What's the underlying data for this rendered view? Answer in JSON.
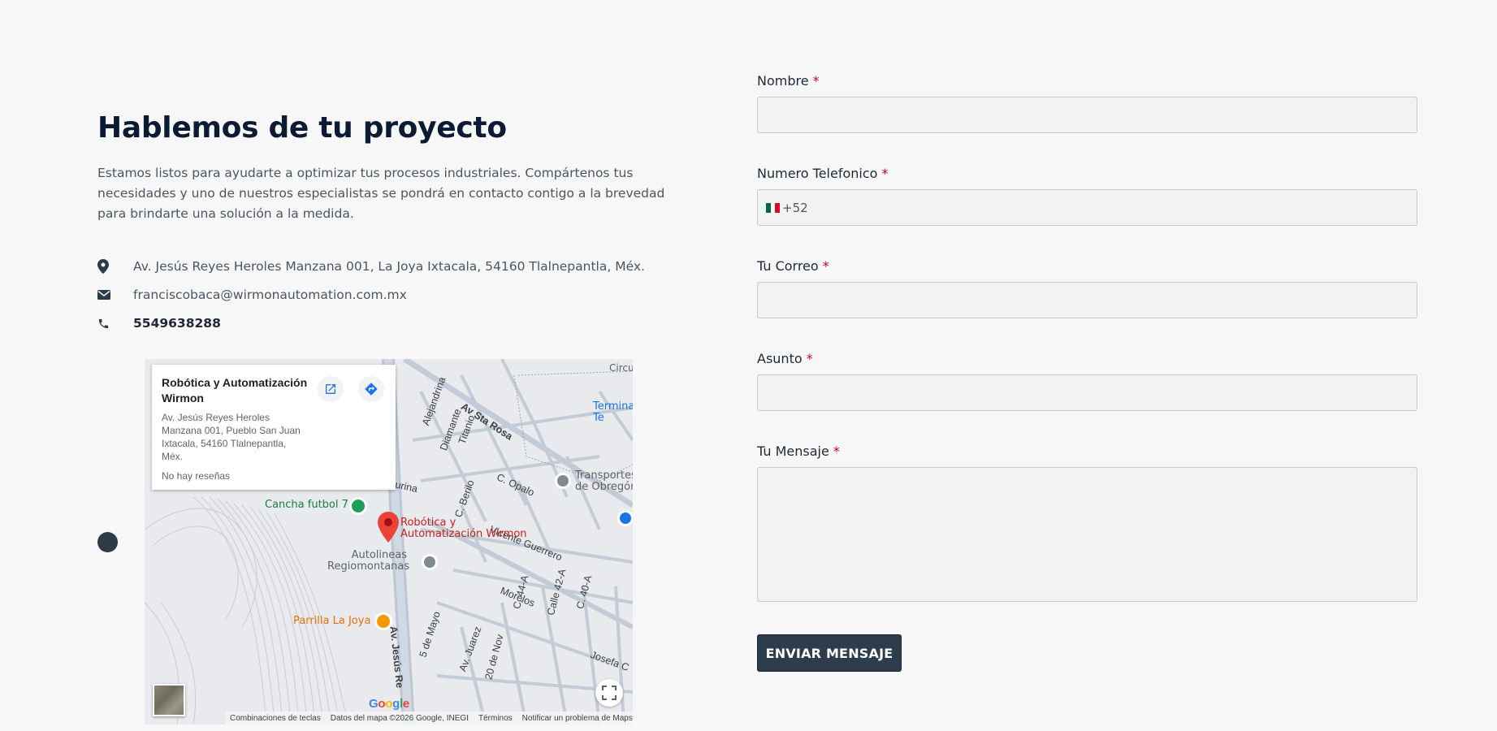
{
  "contact": {
    "headline": "Hablemos de tu proyecto",
    "intro": "Estamos listos para ayudarte a optimizar tus procesos industriales. Compártenos tus necesidades y uno de nuestros especialistas se pondrá en contacto contigo a la brevedad para brindarte una solución a la medida.",
    "address": "Av. Jesús Reyes Heroles Manzana 001, La Joya Ixtacala, 54160 Tlalnepantla, Méx.",
    "email": "franciscobaca@wirmonautomation.com.mx",
    "phone": "5549638288"
  },
  "map": {
    "card_title": "Robótica y Automatización Wirmon",
    "card_address": "Av. Jesús Reyes Heroles Manzana 001, Pueblo San Juan Ixtacala, 54160 Tlalnepantla, Méx.",
    "card_reviews": "No hay reseñas",
    "place_pin_label": "Robótica y Automatización Wirmon",
    "poi_cancha": "Cancha futbol 7",
    "poi_autolineas": "Autolineas Regiomontanas",
    "poi_parrilla": "Parrilla La Joya",
    "poi_transportes": "Transportes de Obregón",
    "poi_terminal": "Terminal Te",
    "poi_circu": "Circu",
    "streets": {
      "alejandrina": "Alejandrina",
      "diamante": "Diamante",
      "titanio": "Titanio",
      "sta_rosa": "Av Sta Rosa",
      "turina": "turina",
      "berilo": "C. Berilo",
      "opalo": "C. Opalo",
      "vicente": "Vicente Guerrero",
      "morelos": "Morelos",
      "cinco_mayo": "5 de Mayo",
      "juarez": "Av. Juarez",
      "veinte_nov": "20 de Nov",
      "jesus_reyes": "Av. Jesús Re",
      "c44": "C. 44-A",
      "calle42": "Calle 42-A",
      "c40": "C. 40-A",
      "josefa": "Josefa C"
    },
    "footer": {
      "shortcuts": "Combinaciones de teclas",
      "data": "Datos del mapa ©2026 Google, INEGI",
      "terms": "Términos",
      "report": "Notificar un problema de Maps"
    },
    "google_logo": "Google"
  },
  "form": {
    "name_label": "Nombre",
    "phone_label": "Numero Telefonico",
    "phone_prefix": "+52",
    "email_label": "Tu Correo",
    "subject_label": "Asunto",
    "message_label": "Tu Mensaje",
    "required_mark": "*",
    "submit_label": "ENVIAR MENSAJE"
  },
  "colors": {
    "accent": "#2e3d4b",
    "required": "#d0021b",
    "map_pin": "#ea4335"
  }
}
